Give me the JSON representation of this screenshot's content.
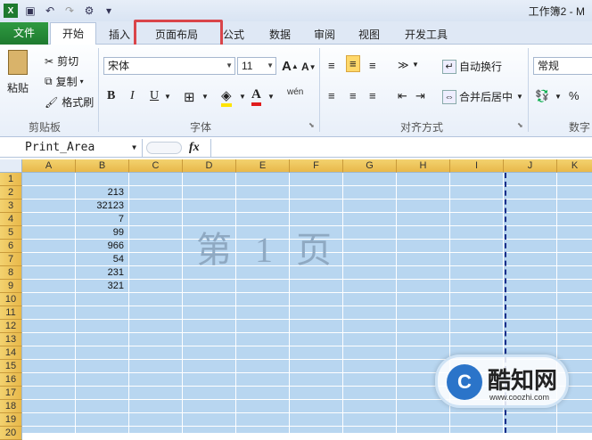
{
  "window": {
    "title": "工作簿2 - M"
  },
  "tabs": [
    {
      "label": "文件"
    },
    {
      "label": "开始"
    },
    {
      "label": "插入"
    },
    {
      "label": "页面布局"
    },
    {
      "label": "公式"
    },
    {
      "label": "数据"
    },
    {
      "label": "审阅"
    },
    {
      "label": "视图"
    },
    {
      "label": "开发工具"
    }
  ],
  "ribbon": {
    "clipboard": {
      "paste": "粘贴",
      "cut": "剪切",
      "copy": "复制",
      "format_painter": "格式刷",
      "group": "剪贴板"
    },
    "font": {
      "name": "宋体",
      "size": "11",
      "group": "字体",
      "bold": "B",
      "italic": "I",
      "underline": "U",
      "grow": "A",
      "shrink": "A",
      "phonetic": "wén"
    },
    "alignment": {
      "wrap": "自动换行",
      "merge": "合并后居中",
      "group": "对齐方式"
    },
    "number": {
      "format": "常规",
      "percent": "%",
      "group": "数字"
    }
  },
  "formula_bar": {
    "name_box": "Print_Area",
    "fx": "fx"
  },
  "columns": [
    "A",
    "B",
    "C",
    "D",
    "E",
    "F",
    "G",
    "H",
    "I",
    "J",
    "K"
  ],
  "rows": [
    "1",
    "2",
    "3",
    "4",
    "5",
    "6",
    "7",
    "8",
    "9",
    "10",
    "11",
    "12",
    "13",
    "14",
    "15",
    "16",
    "17",
    "18",
    "19",
    "20"
  ],
  "cells_B": [
    "",
    "213",
    "32123",
    "7",
    "99",
    "966",
    "54",
    "231",
    "321"
  ],
  "watermark": "第 1 页",
  "logo": {
    "mark": "C",
    "name": "酷知网",
    "url": "www.coozhi.com"
  }
}
